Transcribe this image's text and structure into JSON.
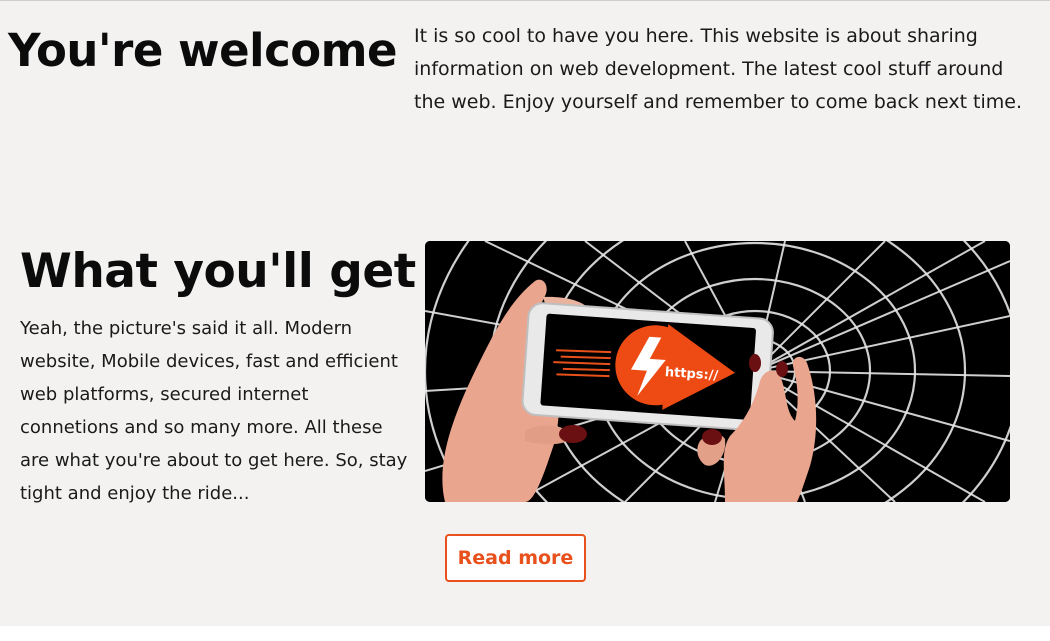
{
  "welcome": {
    "title": "You're welcome",
    "text": "It is so cool to have you here. This website is about sharing information on web development. The latest cool stuff around the web. Enjoy yourself and remember to come back next time."
  },
  "features": {
    "title": "What you'll get",
    "text": "Yeah, the picture's said it all. Modern website, Mobile devices, fast and efficient web platforms, secured internet connetions and so many more. All these are what you're about to get here. So, stay tight and enjoy the ride...",
    "image": {
      "icon": "phone-https-icon",
      "screen_label": "https://"
    },
    "read_more_label": "Read more"
  },
  "colors": {
    "background": "#f3f2f1",
    "accent": "#e8501c",
    "text": "#111111"
  }
}
